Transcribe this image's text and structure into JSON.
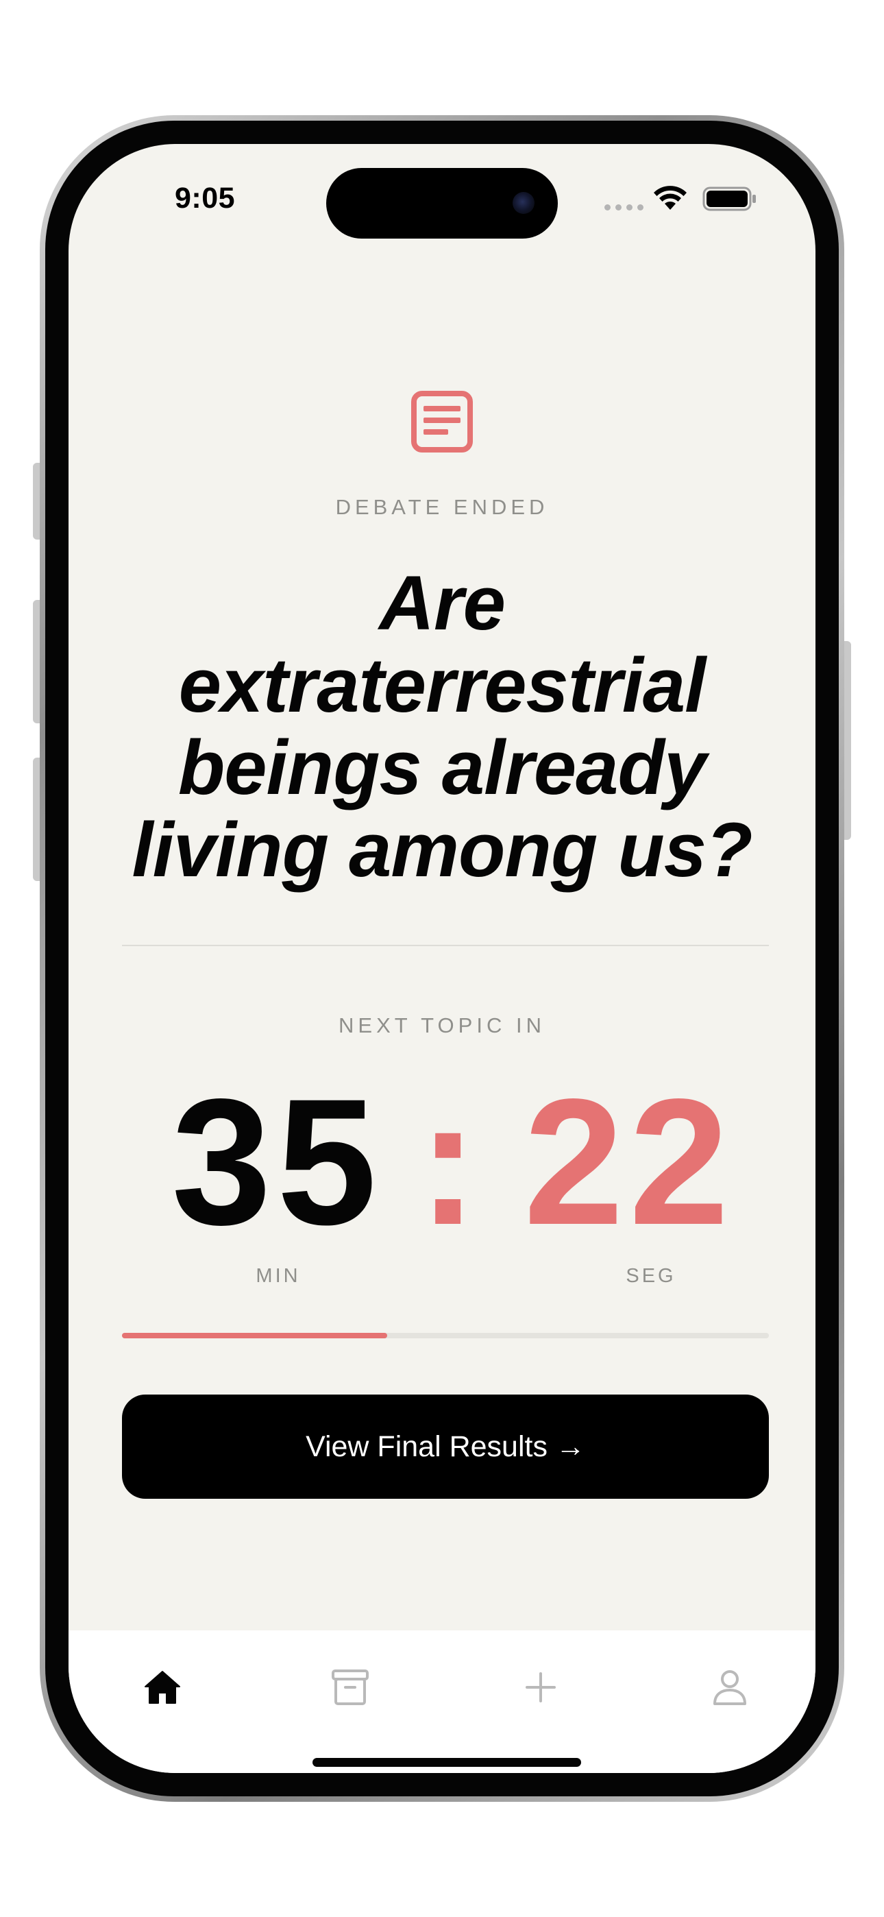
{
  "status_bar": {
    "time": "9:05"
  },
  "debate": {
    "icon": "document-icon",
    "status_label": "DEBATE ENDED",
    "topic": "Are extraterrestrial beings already living among us?"
  },
  "countdown": {
    "label": "NEXT TOPIC IN",
    "minutes": "35",
    "separator": ":",
    "seconds": "22",
    "minutes_label": "MIN",
    "seconds_label": "SEG",
    "progress_fraction": 0.41
  },
  "cta": {
    "label": "View Final Results →"
  },
  "tab_bar": {
    "items": [
      {
        "name": "home",
        "icon": "home-icon",
        "active": true
      },
      {
        "name": "archive",
        "icon": "archive-icon",
        "active": false
      },
      {
        "name": "add",
        "icon": "plus-icon",
        "active": false
      },
      {
        "name": "profile",
        "icon": "profile-icon",
        "active": false
      }
    ]
  },
  "colors": {
    "accent": "#e57373",
    "background": "#f4f3ee",
    "text": "#050505",
    "muted": "#8f8f8b",
    "inactive_icon": "#b9b9b9"
  }
}
